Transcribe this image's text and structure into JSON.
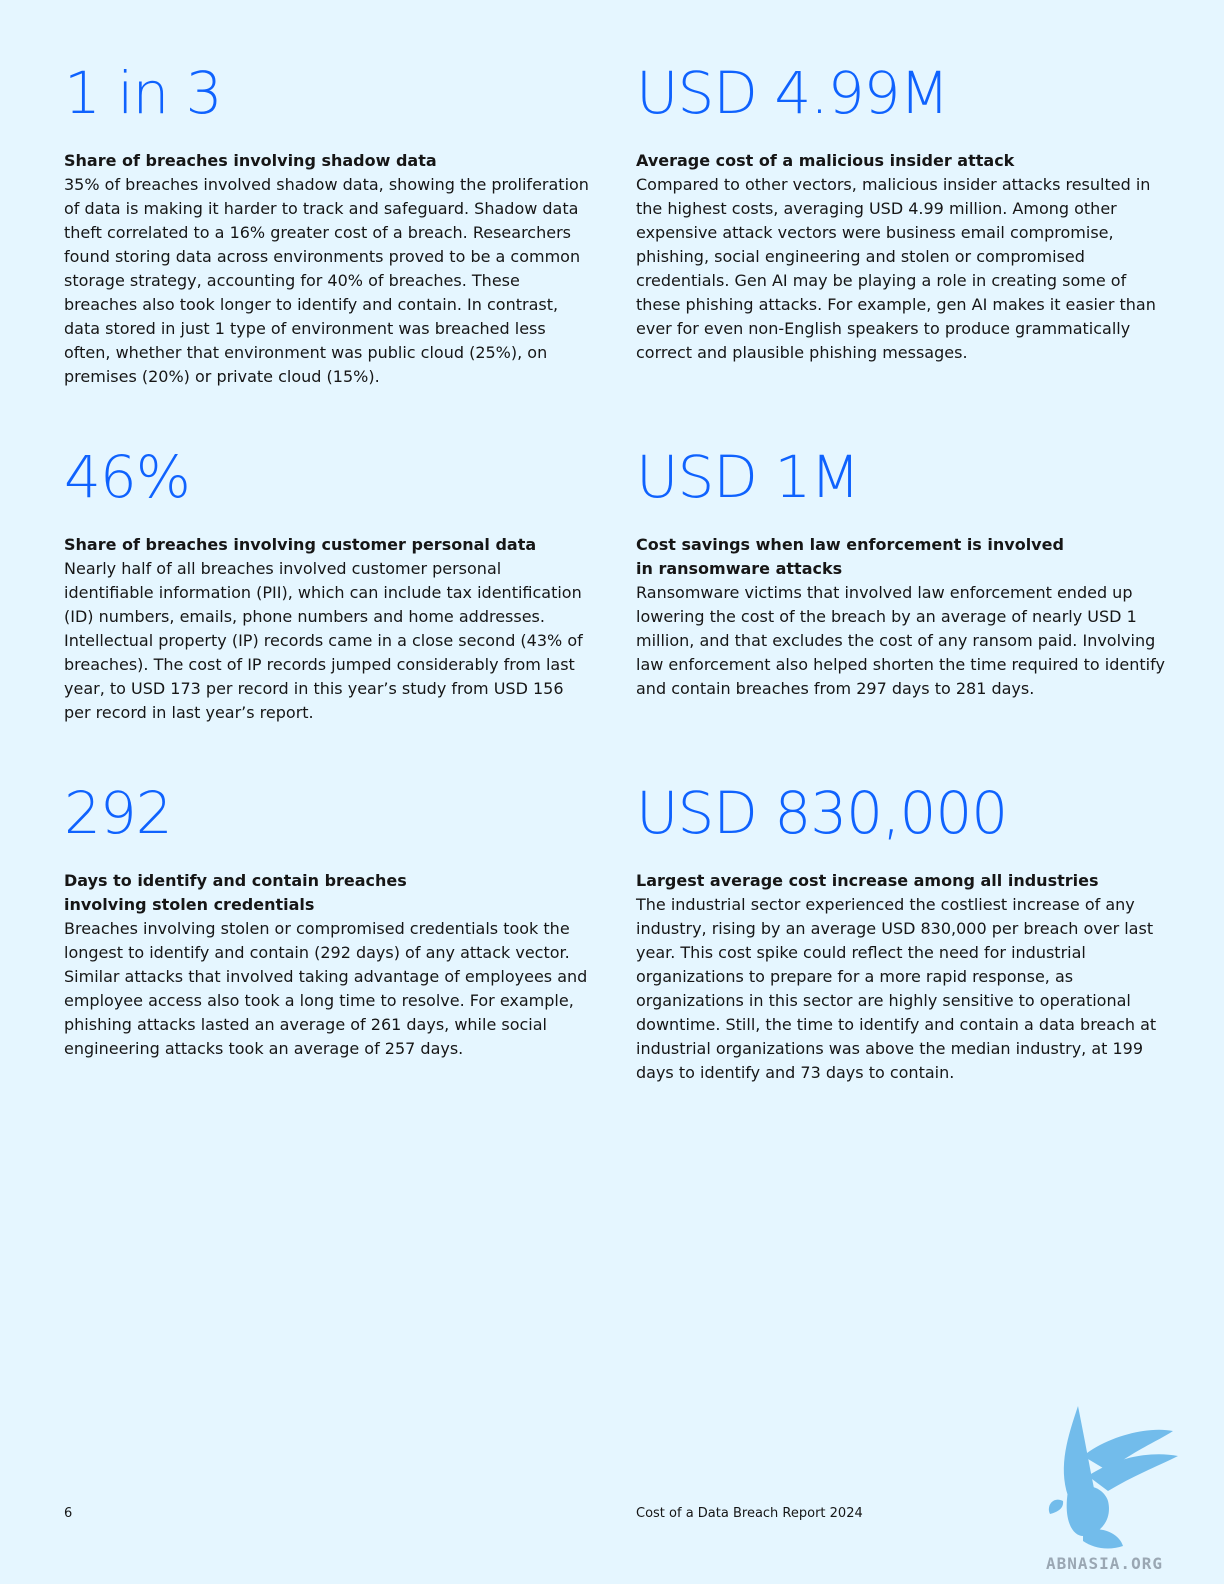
{
  "stats": [
    {
      "value": "1 in 3",
      "heading": "Share of breaches involving shadow data",
      "text": "35% of breaches involved shadow data, showing the proliferation of data is making it harder to track and safeguard. Shadow data theft correlated to a 16% greater cost of a breach. Researchers found storing data across environments proved to be a common storage strategy, accounting for 40% of breaches. These breaches also took longer to identify and contain. In contrast, data stored in just 1 type of environment was breached less often, whether that environment was public cloud (25%), on premises (20%) or private cloud (15%)."
    },
    {
      "value": "USD 4.99M",
      "heading": "Average cost of a malicious insider attack",
      "text": "Compared to other vectors, malicious insider attacks resulted in the highest costs, averaging USD 4.99 million. Among other expensive attack vectors were business email compromise, phishing, social engineering and stolen or compromised credentials. Gen AI may be playing a role in creating some of these phishing attacks. For example, gen AI makes it easier than ever for even non-English speakers to produce grammatically correct and plausible phishing messages."
    },
    {
      "value": "46%",
      "heading": "Share of breaches involving customer personal data",
      "text": "Nearly half of all breaches involved customer personal identifiable information (PII), which can include tax identification (ID) numbers, emails, phone numbers and home addresses. Intellectual property (IP) records came in a close second (43% of breaches). The cost of IP records jumped considerably from last year, to USD 173 per record in this year’s study from USD 156 per record in last year’s report."
    },
    {
      "value": "USD 1M",
      "heading": "Cost savings when law enforcement is involved in ransomware attacks",
      "text": "Ransomware victims that involved law enforcement ended up lowering the cost of the breach by an average of nearly USD 1 million, and that excludes the cost of any ransom paid. Involving law enforcement also helped shorten the time required to identify and contain breaches from 297 days to 281 days."
    },
    {
      "value": "292",
      "heading": "Days to identify and contain breaches involving stolen credentials",
      "text": "Breaches involving stolen or compromised credentials took the longest to identify and contain (292 days) of any attack vector. Similar attacks that involved taking advantage of employees and employee access also took a long time to resolve. For example, phishing attacks lasted an average of 261 days, while social engineering attacks took an average of 257 days."
    },
    {
      "value": "USD 830,000",
      "heading": "Largest average cost increase among all industries",
      "text": "The industrial sector experienced the costliest increase of any industry, rising by an average USD 830,000 per breach over last year. This cost spike could reflect the need for industrial organizations to prepare for a more rapid response, as organizations in this sector are highly sensitive to operational downtime. Still, the time to identify and contain a data breach at industrial organizations was above the median industry, at 199 days to identify and 73 days to contain."
    }
  ],
  "footer": {
    "page_number": "6",
    "report_title": "Cost of a Data Breach Report 2024"
  },
  "watermark": {
    "text": "ABNASIA.ORG",
    "icon": "griffin-logo-icon"
  },
  "colors": {
    "background": "#e5f6ff",
    "accent": "#0f62fe",
    "text": "#161616"
  }
}
